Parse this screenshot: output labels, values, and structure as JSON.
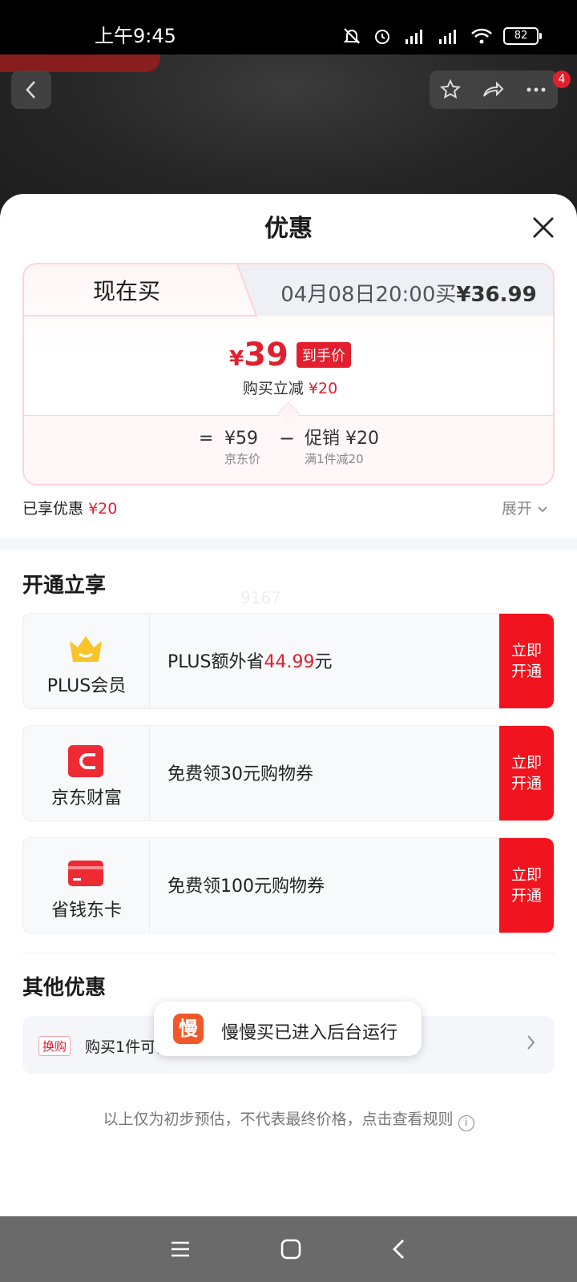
{
  "status_bar": {
    "time": "上午9:45",
    "battery": "82"
  },
  "top_actions": {
    "notification_count": "4"
  },
  "sheet": {
    "title": "优惠",
    "tabs": {
      "now": "现在买",
      "future_prefix": "04月08日20:00买",
      "future_price": "¥36.99"
    },
    "final_price": {
      "currency": "¥",
      "amount": "39",
      "tag": "到手价"
    },
    "reduce": {
      "label": "购买立减",
      "amount": "¥20"
    },
    "calc": {
      "equals": "=",
      "base_price": "¥59",
      "base_label": "京东价",
      "minus": "−",
      "promo": "促销 ¥20",
      "promo_label": "满1件减20"
    },
    "enjoyed": {
      "label": "已享优惠",
      "amount": "¥20",
      "expand": "展开"
    }
  },
  "open_section": {
    "title": "开通立享",
    "watermark": "9167",
    "cards": [
      {
        "name": "PLUS会员",
        "desc_prefix": "PLUS额外省",
        "desc_highlight": "44.99",
        "desc_suffix": "元",
        "btn_line1": "立即",
        "btn_line2": "开通"
      },
      {
        "name": "京东财富",
        "desc_prefix": "免费领30元购物券",
        "desc_highlight": "",
        "desc_suffix": "",
        "btn_line1": "立即",
        "btn_line2": "开通"
      },
      {
        "name": "省钱东卡",
        "desc_prefix": "免费领100元购物券",
        "desc_highlight": "",
        "desc_suffix": "",
        "btn_line1": "立即",
        "btn_line2": "开通"
      }
    ]
  },
  "other_section": {
    "title": "其他优惠",
    "swap": {
      "tag": "换购",
      "text": "购买1件可优惠换购热销商品"
    }
  },
  "disclaimer": "以上仅为初步预估，不代表最终价格，点击查看规则",
  "toast": {
    "icon_char": "慢",
    "text": "慢慢买已进入后台运行"
  },
  "colors": {
    "accent_red": "#e21f2e",
    "button_red": "#f1141e"
  }
}
